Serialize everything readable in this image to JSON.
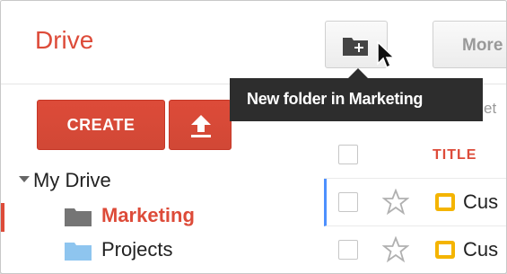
{
  "app": {
    "title": "Drive"
  },
  "toolbar": {
    "new_folder_icon_name": "folder-plus-icon",
    "more_label": "More"
  },
  "tooltip": {
    "text": "New folder in Marketing"
  },
  "sidebar": {
    "create_label": "CREATE",
    "upload_icon_name": "upload-icon",
    "tree_root": "My Drive",
    "folders": [
      {
        "label": "Marketing",
        "active": true,
        "color": "#757575"
      },
      {
        "label": "Projects",
        "active": false,
        "color": "#8ec5ef"
      }
    ]
  },
  "file_list": {
    "title_header": "TITLE",
    "rows": [
      {
        "name": "Cus",
        "starred": false,
        "icon": "slides-icon"
      },
      {
        "name": "Cus",
        "starred": false,
        "icon": "slides-icon"
      }
    ],
    "partial_text_behind_tooltip": "et"
  },
  "colors": {
    "accent": "#dd4b39",
    "selection": "#4d90fe",
    "slides_yellow": "#f4b400",
    "tooltip_bg": "#2d2d2d"
  }
}
